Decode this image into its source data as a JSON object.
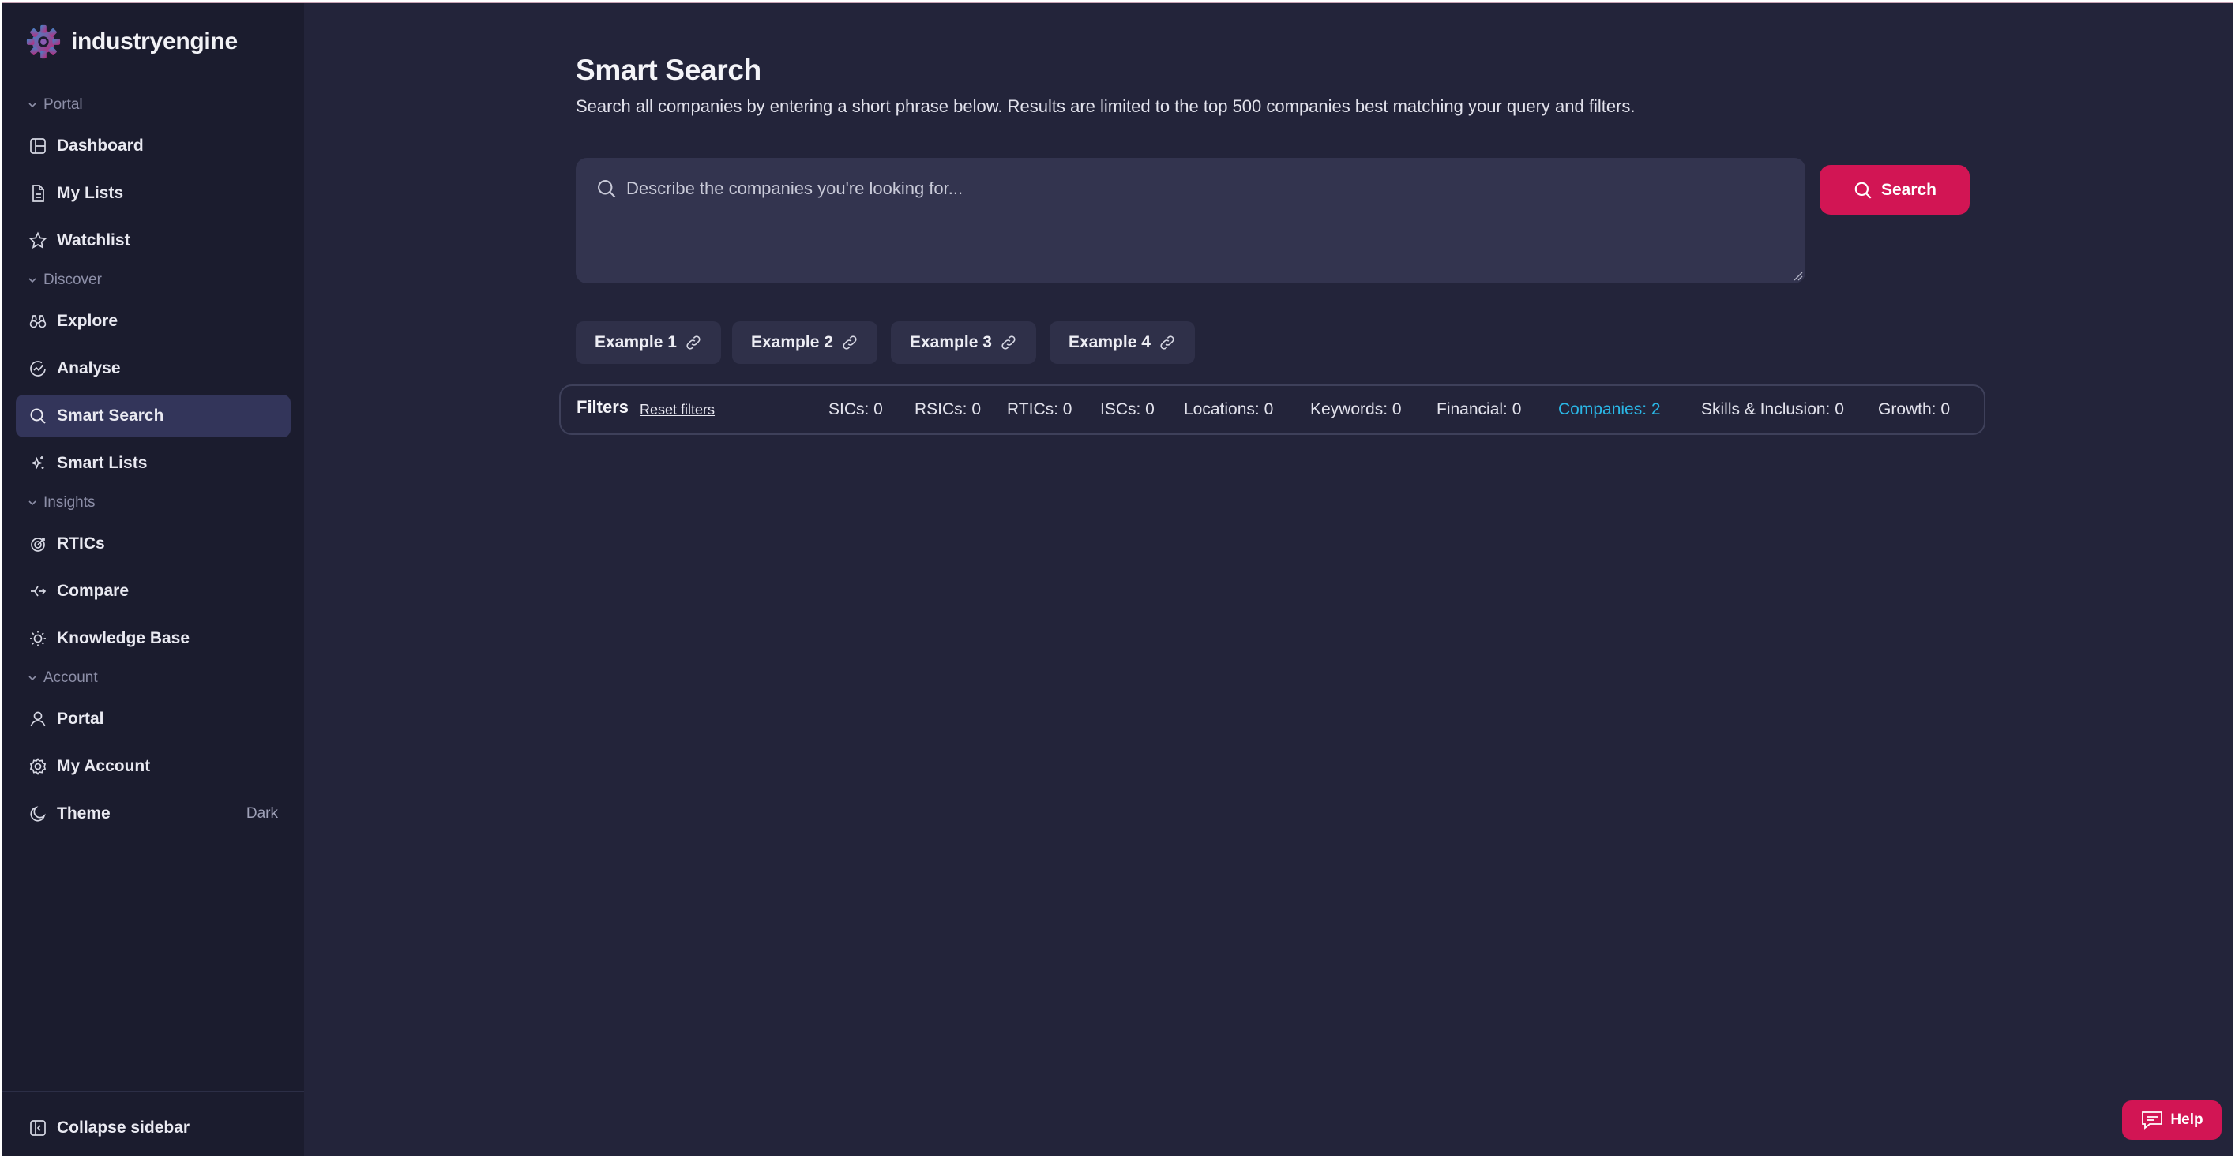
{
  "app": {
    "brand_name": "industryengine"
  },
  "sidebar": {
    "sections": {
      "portal": "Portal",
      "discover": "Discover",
      "insights": "Insights",
      "account": "Account"
    },
    "items": {
      "dashboard": {
        "label": "Dashboard",
        "icon": "dashboard-icon"
      },
      "my_lists": {
        "label": "My Lists",
        "icon": "document-icon"
      },
      "watchlist": {
        "label": "Watchlist",
        "icon": "star-icon"
      },
      "explore": {
        "label": "Explore",
        "icon": "binoculars-icon"
      },
      "analyse": {
        "label": "Analyse",
        "icon": "chart-icon"
      },
      "smart_search": {
        "label": "Smart Search",
        "icon": "search-icon",
        "active": true
      },
      "smart_lists": {
        "label": "Smart Lists",
        "icon": "sparkle-icon"
      },
      "rtics": {
        "label": "RTICs",
        "icon": "target-icon"
      },
      "compare": {
        "label": "Compare",
        "icon": "compare-icon"
      },
      "knowledge_base": {
        "label": "Knowledge Base",
        "icon": "lightbulb-icon"
      },
      "portal": {
        "label": "Portal",
        "icon": "user-icon"
      },
      "my_account": {
        "label": "My Account",
        "icon": "gear-icon"
      },
      "theme": {
        "label": "Theme",
        "value": "Dark",
        "icon": "moon-icon"
      }
    },
    "collapse_label": "Collapse sidebar"
  },
  "main": {
    "title": "Smart Search",
    "description": "Search all companies by entering a short phrase below. Results are limited to the top 500 companies best matching your query and filters.",
    "search": {
      "placeholder": "Describe the companies you're looking for...",
      "value": "",
      "button_label": "Search"
    },
    "examples": [
      "Example 1",
      "Example 2",
      "Example 3",
      "Example 4"
    ],
    "filters": {
      "label": "Filters",
      "reset_label": "Reset filters",
      "items": [
        {
          "label": "SICs: 0"
        },
        {
          "label": "RSICs: 0"
        },
        {
          "label": "RTICs: 0"
        },
        {
          "label": "ISCs: 0"
        },
        {
          "label": "Locations: 0"
        },
        {
          "label": "Keywords: 0"
        },
        {
          "label": "Financial: 0"
        },
        {
          "label": "Companies: 2",
          "active": true
        },
        {
          "label": "Skills & Inclusion: 0"
        },
        {
          "label": "Growth: 0"
        }
      ]
    },
    "help_label": "Help"
  },
  "colors": {
    "background": "#23243a",
    "sidebar": "#1b1c2e",
    "accent": "#d21554",
    "active_filter": "#2ab7e6",
    "active_nav": "#33355a"
  }
}
